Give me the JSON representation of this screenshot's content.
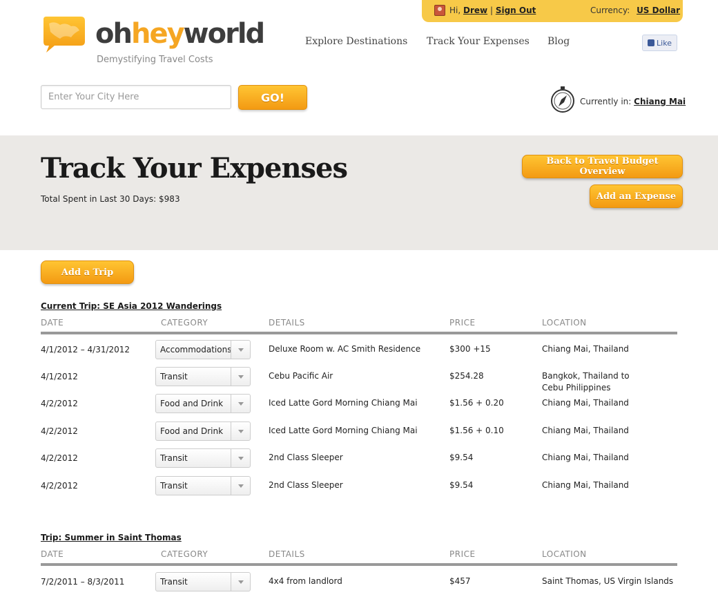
{
  "userbar": {
    "greeting": "Hi,",
    "user": "Drew",
    "separator": "|",
    "signout": "Sign Out",
    "currency_label": "Currency:",
    "currency": "US Dollar"
  },
  "brand": {
    "oh": "oh",
    "hey": "hey",
    "world": "world",
    "tagline": "Demystifying Travel Costs"
  },
  "nav": {
    "explore": "Explore Destinations",
    "track": "Track Your Expenses",
    "blog": "Blog",
    "like": "Like"
  },
  "search": {
    "placeholder": "Enter Your City Here",
    "go": "GO!"
  },
  "location": {
    "label": "Currently in:",
    "city": "Chiang Mai"
  },
  "hero": {
    "title": "Track Your Expenses",
    "total": "Total Spent in Last 30 Days: $983",
    "back_btn": "Back to Travel Budget Overview",
    "add_expense": "Add an Expense"
  },
  "add_trip": "Add a Trip",
  "columns": {
    "date": "DATE",
    "category": "CATEGORY",
    "details": "DETAILS",
    "price": "PRICE",
    "location": "LOCATION"
  },
  "trips": [
    {
      "title": "Current Trip: SE Asia 2012 Wanderings",
      "rows": [
        {
          "date": "4/1/2012 – 4/31/2012",
          "category": "Accommodations",
          "details": "Deluxe Room w. AC Smith Residence",
          "price": "$300 +15",
          "location": "Chiang Mai, Thailand"
        },
        {
          "date": "4/1/2012",
          "category": "Transit",
          "details": "Cebu Pacific Air",
          "price": "$254.28",
          "location": "Bangkok, Thailand to",
          "location2": "Cebu Philippines"
        },
        {
          "date": "4/2/2012",
          "category": "Food and Drink",
          "details": "Iced Latte Gord Morning Chiang Mai",
          "price": "$1.56 + 0.20",
          "location": "Chiang Mai, Thailand"
        },
        {
          "date": "4/2/2012",
          "category": "Food and Drink",
          "details": "Iced Latte Gord Morning Chiang Mai",
          "price": "$1.56 + 0.10",
          "location": "Chiang Mai, Thailand"
        },
        {
          "date": "4/2/2012",
          "category": "Transit",
          "details": "2nd Class Sleeper",
          "price": "$9.54",
          "location": "Chiang Mai, Thailand"
        },
        {
          "date": "4/2/2012",
          "category": "Transit",
          "details": "2nd Class Sleeper",
          "price": "$9.54",
          "location": "Chiang Mai, Thailand"
        }
      ]
    },
    {
      "title": "Trip: Summer in Saint Thomas",
      "rows": [
        {
          "date": "7/2/2011 – 8/3/2011",
          "category": "Transit",
          "details": "4x4 from landlord",
          "price": "$457",
          "location": "Saint Thomas, US Virgin Islands"
        }
      ]
    }
  ]
}
